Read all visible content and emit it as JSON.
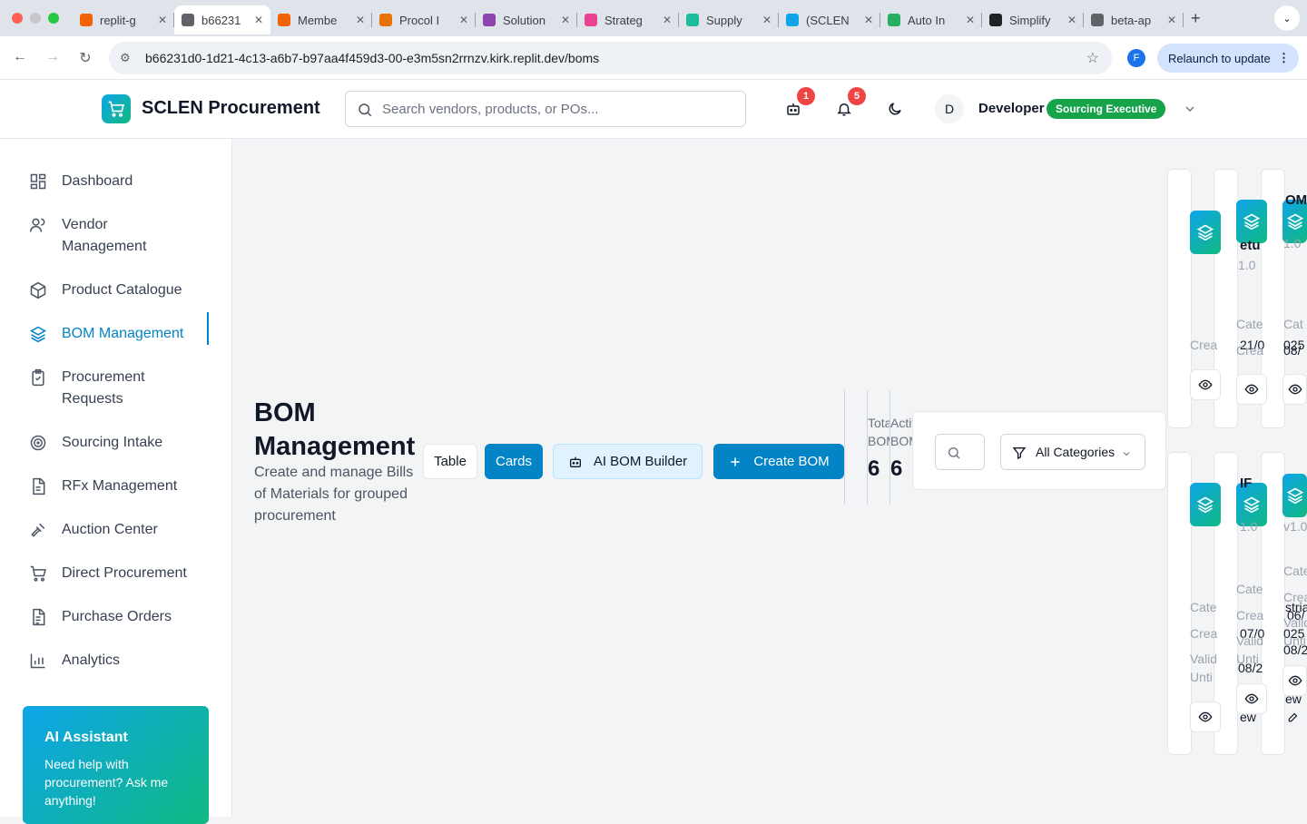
{
  "browser": {
    "tabs": [
      {
        "title": "replit-g",
        "color": "#f26207"
      },
      {
        "title": "b66231",
        "color": "#5f6368"
      },
      {
        "title": "Membe",
        "color": "#f26207"
      },
      {
        "title": "Procol I",
        "color": "#e8710a"
      },
      {
        "title": "Solution",
        "color": "#8e44ad"
      },
      {
        "title": "Strateg",
        "color": "#e84393"
      },
      {
        "title": "Supply",
        "color": "#1abc9c"
      },
      {
        "title": "(SCLEN",
        "color": "#0ea5e9"
      },
      {
        "title": "Auto In",
        "color": "#27ae60"
      },
      {
        "title": "Simplify",
        "color": "#202124"
      },
      {
        "title": "beta-ap",
        "color": "#5f6368"
      }
    ],
    "active_tab_index": 1,
    "url": "b66231d0-1d21-4c13-a6b7-b97aa4f459d3-00-e3m5sn2rrnzv.kirk.replit.dev/boms",
    "profile_initial": "F",
    "relaunch_label": "Relaunch to update"
  },
  "header": {
    "brand": "SCLEN Procurement",
    "search_placeholder": "Search vendors, products, or POs...",
    "ai_badge": "1",
    "notif_badge": "5",
    "avatar_initial": "D",
    "user_name": "Developer",
    "role": "Sourcing Executive"
  },
  "sidebar": {
    "items": [
      {
        "label": "Dashboard",
        "icon": "dashboard-icon"
      },
      {
        "label": "Vendor Management",
        "icon": "users-icon"
      },
      {
        "label": "Product Catalogue",
        "icon": "package-icon"
      },
      {
        "label": "BOM Management",
        "icon": "layers-icon"
      },
      {
        "label": "Procurement Requests",
        "icon": "clipboard-icon"
      },
      {
        "label": "Sourcing Intake",
        "icon": "target-icon"
      },
      {
        "label": "RFx Management",
        "icon": "file-icon"
      },
      {
        "label": "Auction Center",
        "icon": "gavel-icon"
      },
      {
        "label": "Direct Procurement",
        "icon": "cart-icon"
      },
      {
        "label": "Purchase Orders",
        "icon": "file-text-icon"
      },
      {
        "label": "Analytics",
        "icon": "bar-chart-icon"
      }
    ],
    "active_index": 3,
    "ai_card": {
      "title": "AI Assistant",
      "text": "Need help with procurement? Ask me anything!"
    }
  },
  "main": {
    "title": "BOM Management",
    "subtitle": "Create and manage Bills of Materials for grouped procurement",
    "view_table": "Table",
    "view_cards": "Cards",
    "ai_builder": "AI BOM Builder",
    "create": "Create BOM",
    "stats": [
      {
        "label": "Total BOMs",
        "value": "6"
      },
      {
        "label": "Active BOMs",
        "value": "6"
      },
      {
        "label": "",
        "value": ""
      }
    ],
    "category_filter": "All Categories"
  },
  "cards_fragments": {
    "c1_label1": "Crea",
    "c2_title": "etu",
    "c2_version": "1.0",
    "c2_cat": "Cate",
    "c2_created": "21/0",
    "c2_created_lbl": "Crea",
    "c3_title": "OM",
    "c3_version": "1.0",
    "c3_cat": "Cat",
    "c3_date1": "025",
    "c3_date2": "08/",
    "r2c1_cat": "Cate",
    "r2c1_created": "Crea",
    "r2c1_valid": "Valid",
    "r2c1_until": "Unti",
    "r2c2_title": "IF",
    "r2c2_version": "1.0",
    "r2c2_cat": "Cate",
    "r2c2_created": "Crea",
    "r2c2_date": "07/0",
    "r2c2_valid": "Valid",
    "r2c2_until": "Unti",
    "r2c2_date2": "08/2",
    "r2c2_view": "ew",
    "r2c3_version": "v1.0",
    "r2c3_cat": "Cate",
    "r2c3_cat_val": "strial",
    "r2c3_created": "Crea",
    "r2c3_date1": "06/",
    "r2c3_date2": "025",
    "r2c3_valid": "Valid",
    "r2c3_until": "Unti",
    "r2c3_date3": "08/2",
    "r2c3_view": "ew"
  }
}
